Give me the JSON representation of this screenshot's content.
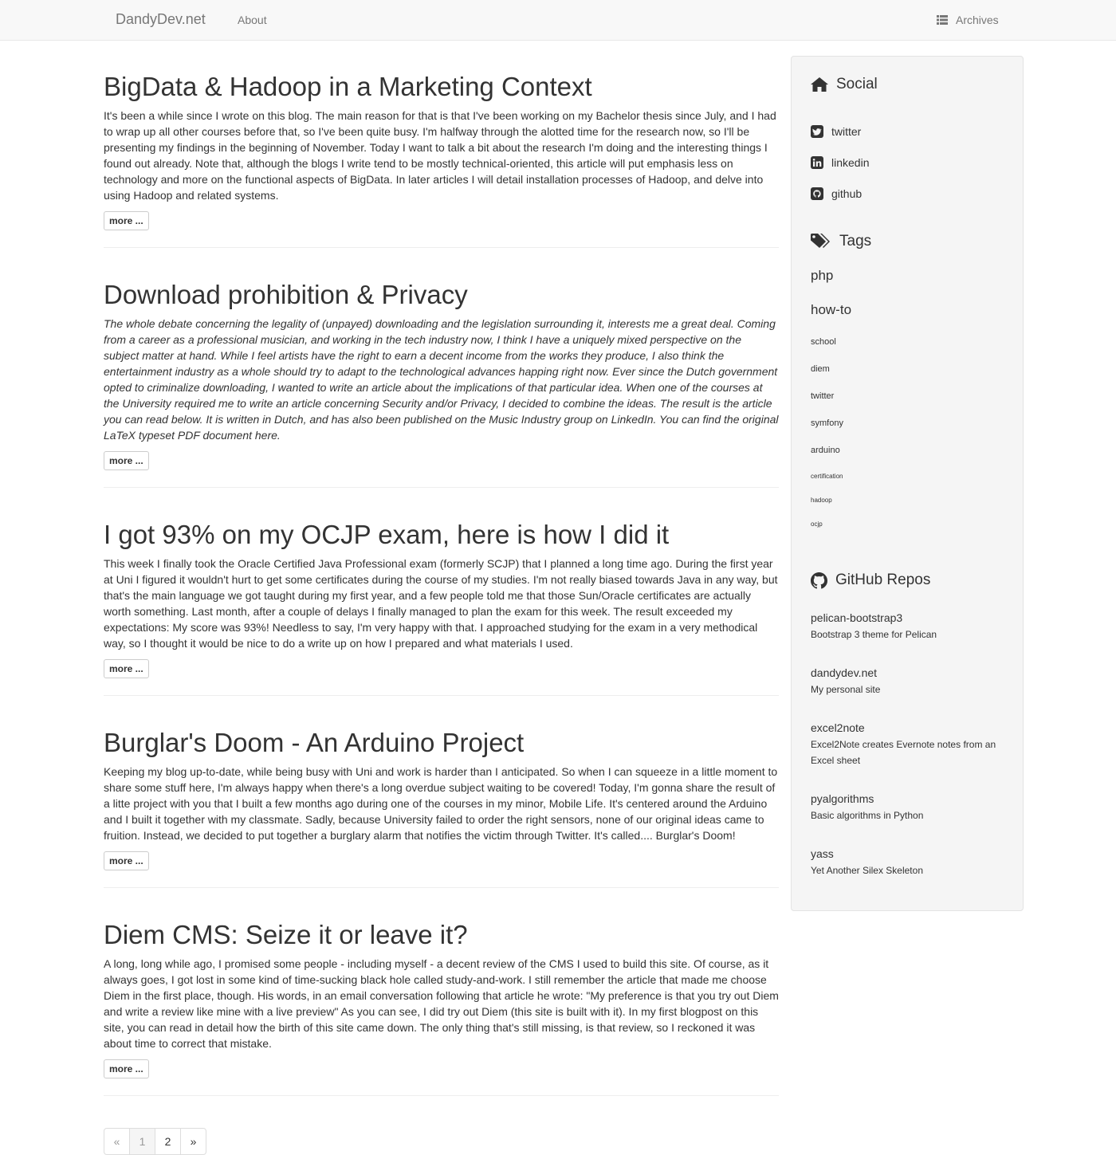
{
  "navbar": {
    "brand": "DandyDev.net",
    "about": "About",
    "archives": "Archives",
    "archives_icon": "list-icon"
  },
  "articles": [
    {
      "title": "BigData & Hadoop in a Marketing Context",
      "summary": "It's been a while since I wrote on this blog. The main reason for that is that I've been working on my Bachelor thesis since July, and I had to wrap up all other courses before that, so I've been quite busy. I'm halfway through the alotted time for the research now, so I'll be presenting my findings in the beginning of November. Today I want to talk a bit about the research I'm doing and the interesting things I found out already. Note that, although the blogs I write tend to be mostly technical-oriented, this article will put emphasis less on technology and more on the functional aspects of BigData. In later articles I will detail installation processes of Hadoop, and delve into using Hadoop and related systems.",
      "italic": false,
      "more": "more ..."
    },
    {
      "title": "Download prohibition & Privacy",
      "summary": "The whole debate concerning the legality of (unpayed) downloading and the legislation surrounding it, interests me a great deal. Coming from a career as a professional musician, and working in the tech industry now, I think I have a uniquely mixed perspective on the subject matter at hand. While I feel artists have the right to earn a decent income from the works they produce, I also think the entertainment industry as a whole should try to adapt to the technological advances happing right now. Ever since the Dutch government opted to criminalize downloading, I wanted to write an article about the implications of that particular idea. When one of the courses at the University required me to write an article concerning Security and/or Privacy, I decided to combine the ideas. The result is the article you can read below. It is written in Dutch, and has also been published on the Music Industry group on LinkedIn. You can find the original LaTeX typeset PDF document here.",
      "italic": true,
      "more": "more ..."
    },
    {
      "title": "I got 93% on my OCJP exam, here is how I did it",
      "summary": "This week I finally took the Oracle Certified Java Professional exam (formerly SCJP) that I planned a long time ago. During the first year at Uni I figured it wouldn't hurt to get some certificates during the course of my studies. I'm not really biased towards Java in any way, but that's the main language we got taught during my first year, and a few people told me that those Sun/Oracle certificates are actually worth something. Last month, after a couple of delays I finally managed to plan the exam for this week. The result exceeded my expectations: My score was 93%! Needless to say, I'm very happy with that. I approached studying for the exam in a very methodical way, so I thought it would be nice to do a write up on how I prepared and what materials I used.",
      "italic": false,
      "more": "more ..."
    },
    {
      "title": "Burglar's Doom - An Arduino Project",
      "summary": "Keeping my blog up-to-date, while being busy with Uni and work is harder than I anticipated. So when I can squeeze in a little moment to share some stuff here, I'm always happy when there's a long overdue subject waiting to be covered! Today, I'm gonna share the result of a litte project with you that I built a few months ago during one of the courses in my minor, Mobile Life. It's centered around the Arduino and I built it together with my classmate. Sadly, because University failed to order the right sensors, none of our original ideas came to fruition. Instead, we decided to put together a burglary alarm that notifies the victim through Twitter. It's called.... Burglar's Doom!",
      "italic": false,
      "more": "more ..."
    },
    {
      "title": "Diem CMS: Seize it or leave it?",
      "summary": "A long, long while ago, I promised some people - including myself - a decent review of the CMS I used to build this site. Of course, as it always goes, I got lost in some kind of time-sucking black hole called study-and-work. I still remember the article that made me choose Diem in the first place, though. His words, in an email conversation following that article he wrote: \"My preference is that you try out Diem and write a review like mine with a live preview\" As you can see, I did try out Diem (this site is built with it). In my first blogpost on this site, you can read in detail how the birth of this site came down. The only thing that's still missing, is that review, so I reckoned it was about time to correct that mistake.",
      "italic": false,
      "more": "more ..."
    }
  ],
  "pagination": {
    "prev": "«",
    "pages": [
      "1",
      "2"
    ],
    "next": "»",
    "active": "1"
  },
  "sidebar": {
    "social": {
      "heading": "Social",
      "icon": "home-icon",
      "items": [
        {
          "label": "twitter",
          "icon": "twitter-icon"
        },
        {
          "label": "linkedin",
          "icon": "linkedin-icon"
        },
        {
          "label": "github",
          "icon": "github-icon"
        }
      ]
    },
    "tags": {
      "heading": "Tags",
      "icon": "tags-icon",
      "items": [
        {
          "label": "php",
          "weight": 1
        },
        {
          "label": "how-to",
          "weight": 1
        },
        {
          "label": "school",
          "weight": 4
        },
        {
          "label": "diem",
          "weight": 4
        },
        {
          "label": "twitter",
          "weight": 4
        },
        {
          "label": "symfony",
          "weight": 4
        },
        {
          "label": "arduino",
          "weight": 4
        },
        {
          "label": "certification",
          "weight": 6
        },
        {
          "label": "hadoop",
          "weight": 6
        },
        {
          "label": "ocjp",
          "weight": 6
        }
      ]
    },
    "repos": {
      "heading": "GitHub Repos",
      "icon": "github-icon",
      "items": [
        {
          "name": "pelican-bootstrap3",
          "desc": "Bootstrap 3 theme for Pelican"
        },
        {
          "name": "dandydev.net",
          "desc": "My personal site"
        },
        {
          "name": "excel2note",
          "desc": "Excel2Note creates Evernote notes from an Excel sheet"
        },
        {
          "name": "pyalgorithms",
          "desc": "Basic algorithms in Python"
        },
        {
          "name": "yass",
          "desc": "Yet Another Silex Skeleton"
        }
      ]
    }
  }
}
